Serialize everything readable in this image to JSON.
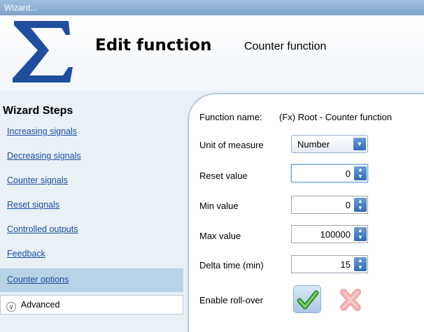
{
  "window": {
    "title": "Wizard..."
  },
  "header": {
    "title": "Edit function",
    "subtitle": "Counter function"
  },
  "sidebar": {
    "title": "Wizard Steps",
    "items": [
      {
        "label": "Increasing signals"
      },
      {
        "label": "Decreasing signals"
      },
      {
        "label": "Counter signals"
      },
      {
        "label": "Reset signals"
      },
      {
        "label": "Controlled outputs"
      },
      {
        "label": "Feedback"
      },
      {
        "label": "Counter options"
      }
    ],
    "selected": "Counter options",
    "advanced_label": "Advanced"
  },
  "form": {
    "function_name_label": "Function name:",
    "function_name_value": "(Fx) Root - Counter function",
    "unit_label": "Unit of measure",
    "unit_value": "Number",
    "reset_label": "Reset value",
    "reset_value": "0",
    "min_label": "Min value",
    "min_value": "0",
    "max_label": "Max value",
    "max_value": "100000",
    "delta_label": "Delta time (min)",
    "delta_value": "15",
    "rollover_label": "Enable roll-over"
  },
  "colors": {
    "link": "#1b4fa3",
    "selected_step": "#b9d3e6",
    "accent": "#2f6bb8"
  }
}
